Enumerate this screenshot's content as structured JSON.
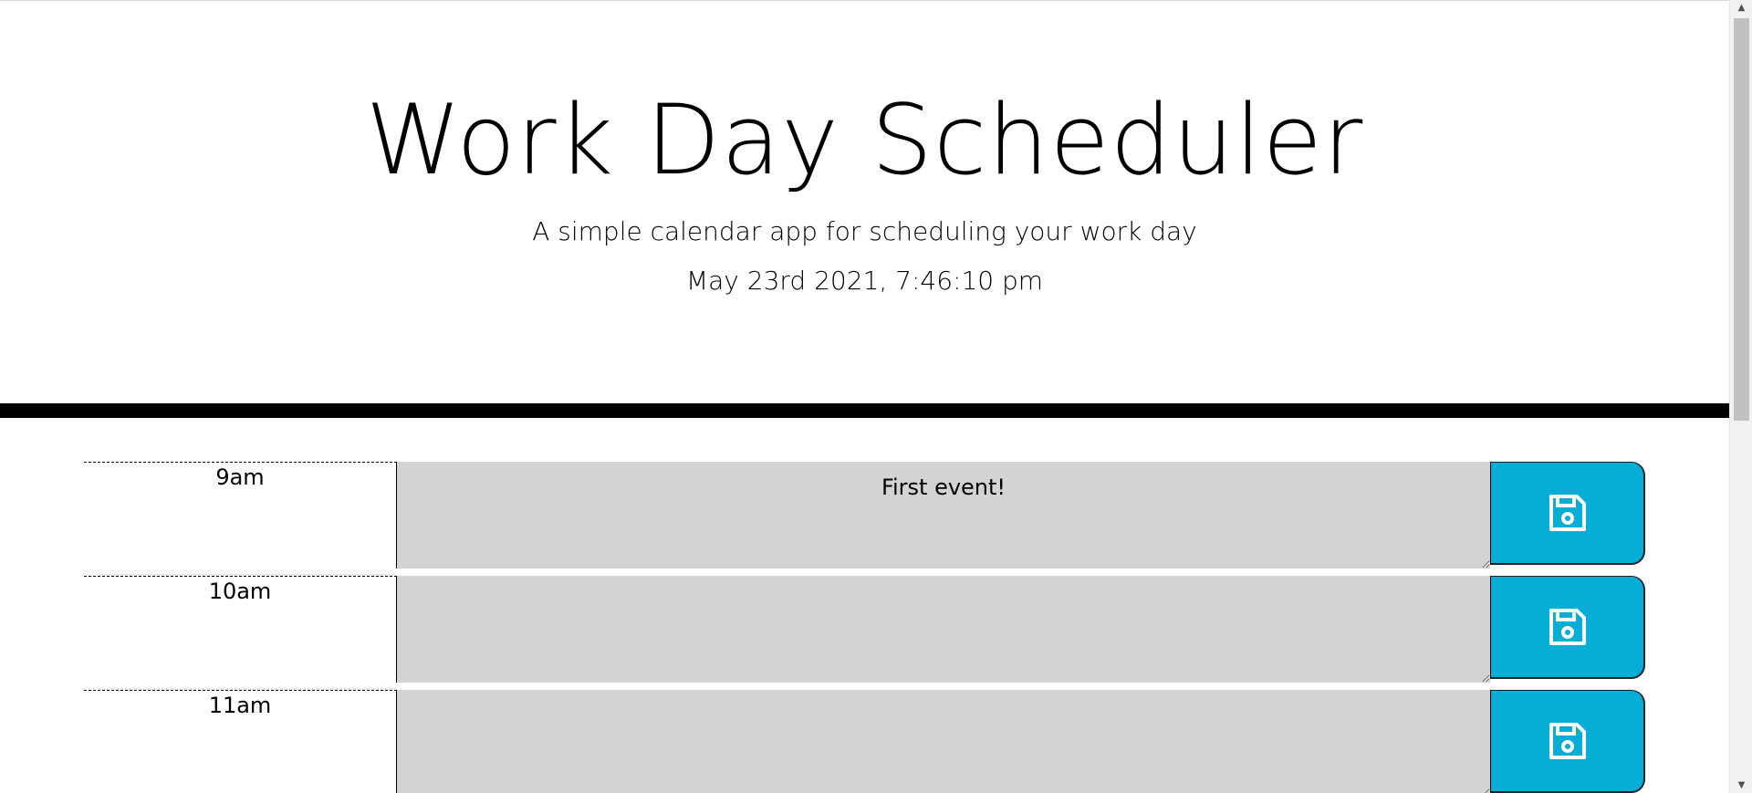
{
  "header": {
    "title": "Work Day Scheduler",
    "subtitle": "A simple calendar app for scheduling your work day",
    "current_day": "May 23rd 2021, 7:46:10 pm"
  },
  "time_blocks": [
    {
      "hour": "9am",
      "description": "First event!"
    },
    {
      "hour": "10am",
      "description": ""
    },
    {
      "hour": "11am",
      "description": ""
    }
  ],
  "save_icon": "floppy-disk-icon",
  "colors": {
    "accent": "#06aed5",
    "past_block": "#d3d3d3",
    "divider": "#000000"
  }
}
